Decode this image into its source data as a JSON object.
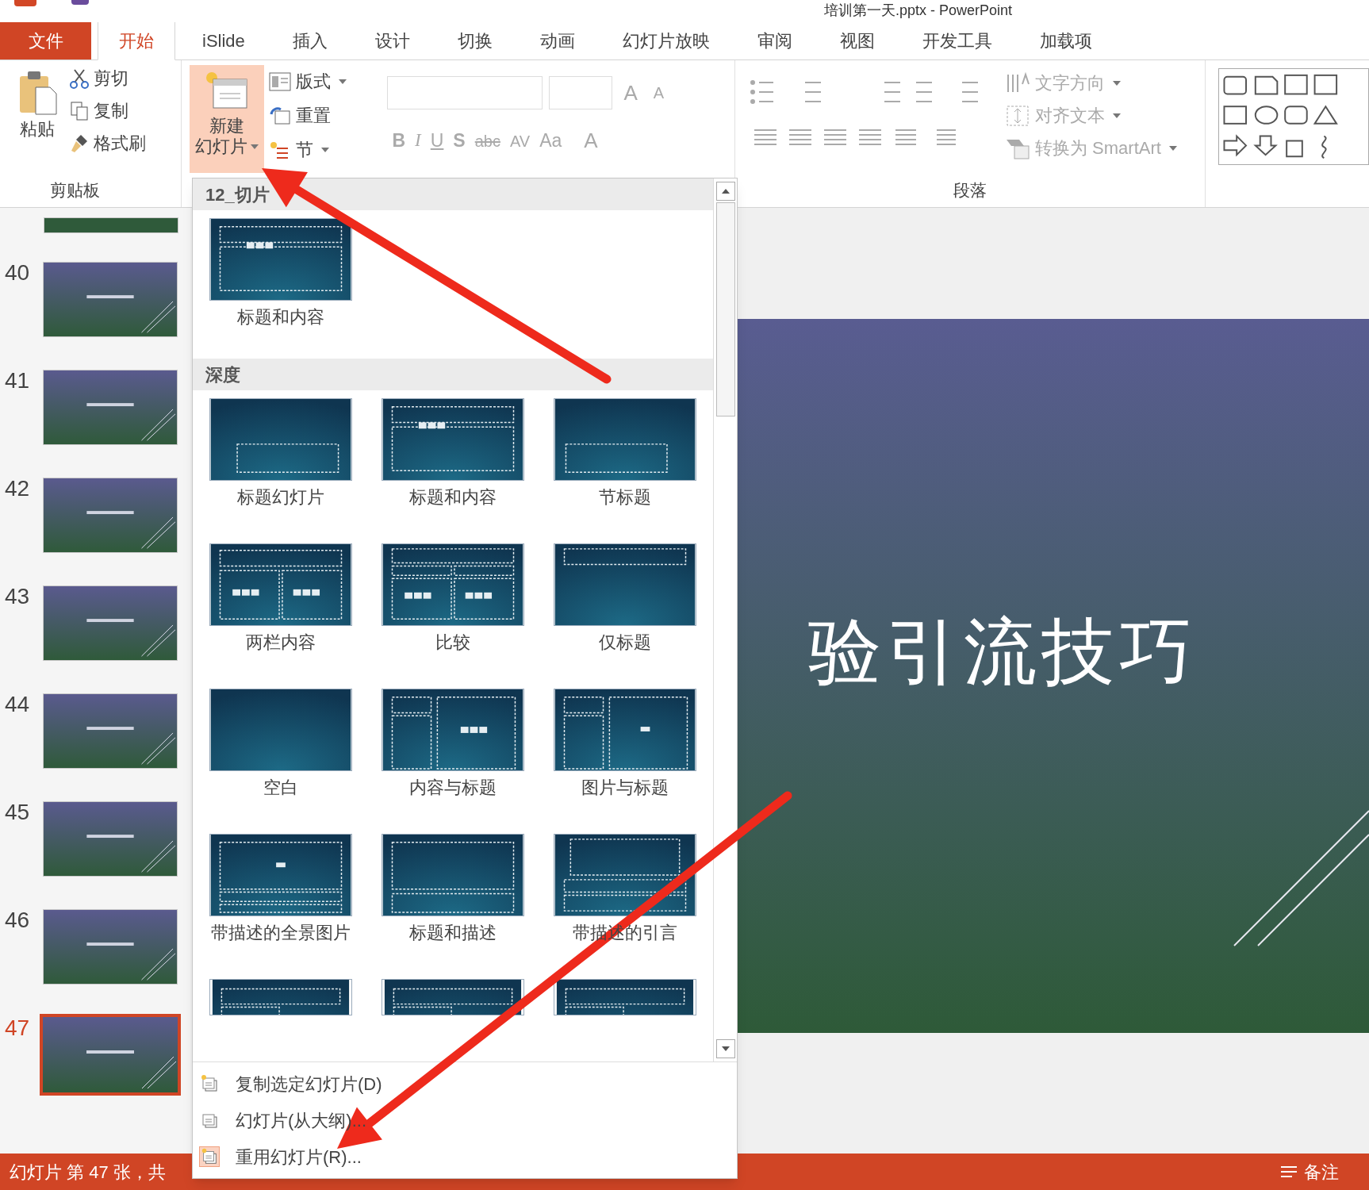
{
  "window": {
    "title": "培训第一天.pptx - PowerPoint"
  },
  "tabs": [
    {
      "label": "文件",
      "kind": "file",
      "selected": false
    },
    {
      "label": "开始",
      "kind": "tab",
      "selected": true
    },
    {
      "label": "iSlide",
      "kind": "tab",
      "selected": false
    },
    {
      "label": "插入",
      "kind": "tab",
      "selected": false
    },
    {
      "label": "设计",
      "kind": "tab",
      "selected": false
    },
    {
      "label": "切换",
      "kind": "tab",
      "selected": false
    },
    {
      "label": "动画",
      "kind": "tab",
      "selected": false
    },
    {
      "label": "幻灯片放映",
      "kind": "tab",
      "selected": false
    },
    {
      "label": "审阅",
      "kind": "tab",
      "selected": false
    },
    {
      "label": "视图",
      "kind": "tab",
      "selected": false
    },
    {
      "label": "开发工具",
      "kind": "tab",
      "selected": false
    },
    {
      "label": "加载项",
      "kind": "tab",
      "selected": false
    }
  ],
  "ribbon": {
    "clipboard": {
      "paste": "粘贴",
      "cut": "剪切",
      "copy": "复制",
      "format_painter": "格式刷",
      "label": "剪贴板"
    },
    "slides": {
      "new_slide_line1": "新建",
      "new_slide_line2": "幻灯片",
      "layout": "版式",
      "reset": "重置",
      "section": "节"
    },
    "font": {
      "grow": "A",
      "shrink": "A",
      "bold": "B",
      "italic": "I",
      "underline": "U",
      "shadow": "S",
      "strike": "abc",
      "spacing": "AV",
      "case": "Aa",
      "font_color_button": "A"
    },
    "paragraph": {
      "text_direction": "文字方向",
      "align_text": "对齐文本",
      "smartart": "转换为 SmartArt",
      "label": "段落"
    }
  },
  "slide_panel": {
    "slides": [
      {
        "number": "40",
        "selected": false
      },
      {
        "number": "41",
        "selected": false
      },
      {
        "number": "42",
        "selected": false
      },
      {
        "number": "43",
        "selected": false
      },
      {
        "number": "44",
        "selected": false
      },
      {
        "number": "45",
        "selected": false
      },
      {
        "number": "46",
        "selected": false
      },
      {
        "number": "47",
        "selected": true
      }
    ]
  },
  "layout_menu": {
    "sections": [
      {
        "title": "12_切片",
        "layouts": [
          {
            "name": "标题和内容",
            "kind": "title-content"
          }
        ]
      },
      {
        "title": "深度",
        "layouts": [
          {
            "name": "标题幻灯片",
            "kind": "title-slide"
          },
          {
            "name": "标题和内容",
            "kind": "title-content"
          },
          {
            "name": "节标题",
            "kind": "section"
          },
          {
            "name": "两栏内容",
            "kind": "two-content"
          },
          {
            "name": "比较",
            "kind": "comparison"
          },
          {
            "name": "仅标题",
            "kind": "title-only"
          },
          {
            "name": "空白",
            "kind": "blank"
          },
          {
            "name": "内容与标题",
            "kind": "content-caption"
          },
          {
            "name": "图片与标题",
            "kind": "picture-caption"
          },
          {
            "name": "带描述的全景图片",
            "kind": "panorama"
          },
          {
            "name": "标题和描述",
            "kind": "title-description"
          },
          {
            "name": "带描述的引言",
            "kind": "quote"
          },
          {
            "kind": "partial"
          },
          {
            "kind": "partial"
          },
          {
            "kind": "partial"
          }
        ]
      }
    ],
    "commands": [
      "复制选定幻灯片(D)",
      "幻灯片(从大纲)...",
      "重用幻灯片(R)..."
    ]
  },
  "slide": {
    "title": "验引流技巧"
  },
  "status_bar": {
    "slide_info": "幻灯片 第 47 张，共",
    "notes": "备注"
  }
}
